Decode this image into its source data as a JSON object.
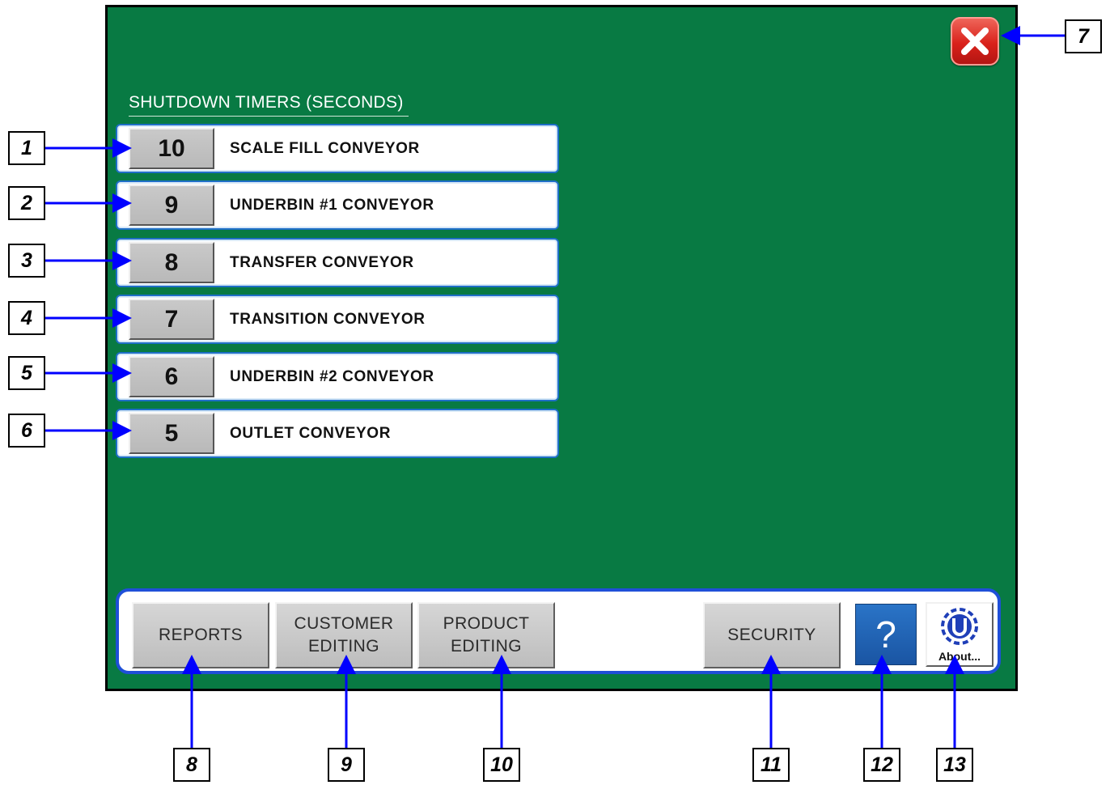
{
  "screen": {
    "close_icon": "close-icon",
    "timers_title": "SHUTDOWN TIMERS (SECONDS)",
    "timers": [
      {
        "value": "10",
        "label": "SCALE FILL CONVEYOR"
      },
      {
        "value": "9",
        "label": "UNDERBIN #1 CONVEYOR"
      },
      {
        "value": "8",
        "label": "TRANSFER CONVEYOR"
      },
      {
        "value": "7",
        "label": "TRANSITION CONVEYOR"
      },
      {
        "value": "6",
        "label": "UNDERBIN #2 CONVEYOR"
      },
      {
        "value": "5",
        "label": "OUTLET CONVEYOR"
      }
    ],
    "bottom_bar": {
      "reports": "REPORTS",
      "customer_editing_1": "CUSTOMER",
      "customer_editing_2": "EDITING",
      "product_editing_1": "PRODUCT",
      "product_editing_2": "EDITING",
      "security": "SECURITY",
      "help": "?",
      "about": "About..."
    }
  },
  "callouts": [
    "1",
    "2",
    "3",
    "4",
    "5",
    "6",
    "7",
    "8",
    "9",
    "10",
    "11",
    "12",
    "13"
  ],
  "colors": {
    "screen_background": "#087a43",
    "row_border": "#1f6fc8",
    "bar_border": "#1f4fd8",
    "close_button": "#d9211a",
    "help_button": "#1a55a3",
    "callout_arrow": "#0000ff"
  }
}
